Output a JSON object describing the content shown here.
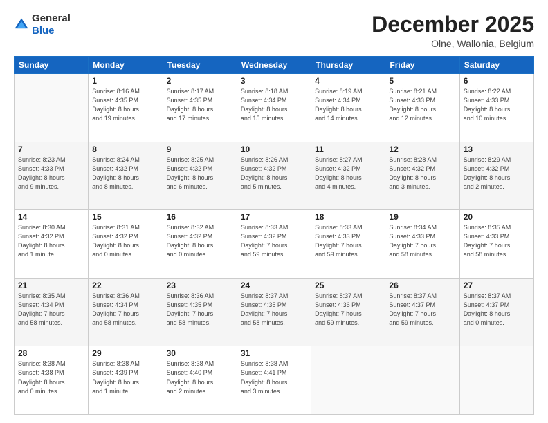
{
  "header": {
    "logo_general": "General",
    "logo_blue": "Blue",
    "month": "December 2025",
    "location": "Olne, Wallonia, Belgium"
  },
  "weekdays": [
    "Sunday",
    "Monday",
    "Tuesday",
    "Wednesday",
    "Thursday",
    "Friday",
    "Saturday"
  ],
  "weeks": [
    [
      {
        "day": "",
        "info": ""
      },
      {
        "day": "1",
        "info": "Sunrise: 8:16 AM\nSunset: 4:35 PM\nDaylight: 8 hours\nand 19 minutes."
      },
      {
        "day": "2",
        "info": "Sunrise: 8:17 AM\nSunset: 4:35 PM\nDaylight: 8 hours\nand 17 minutes."
      },
      {
        "day": "3",
        "info": "Sunrise: 8:18 AM\nSunset: 4:34 PM\nDaylight: 8 hours\nand 15 minutes."
      },
      {
        "day": "4",
        "info": "Sunrise: 8:19 AM\nSunset: 4:34 PM\nDaylight: 8 hours\nand 14 minutes."
      },
      {
        "day": "5",
        "info": "Sunrise: 8:21 AM\nSunset: 4:33 PM\nDaylight: 8 hours\nand 12 minutes."
      },
      {
        "day": "6",
        "info": "Sunrise: 8:22 AM\nSunset: 4:33 PM\nDaylight: 8 hours\nand 10 minutes."
      }
    ],
    [
      {
        "day": "7",
        "info": "Sunrise: 8:23 AM\nSunset: 4:33 PM\nDaylight: 8 hours\nand 9 minutes."
      },
      {
        "day": "8",
        "info": "Sunrise: 8:24 AM\nSunset: 4:32 PM\nDaylight: 8 hours\nand 8 minutes."
      },
      {
        "day": "9",
        "info": "Sunrise: 8:25 AM\nSunset: 4:32 PM\nDaylight: 8 hours\nand 6 minutes."
      },
      {
        "day": "10",
        "info": "Sunrise: 8:26 AM\nSunset: 4:32 PM\nDaylight: 8 hours\nand 5 minutes."
      },
      {
        "day": "11",
        "info": "Sunrise: 8:27 AM\nSunset: 4:32 PM\nDaylight: 8 hours\nand 4 minutes."
      },
      {
        "day": "12",
        "info": "Sunrise: 8:28 AM\nSunset: 4:32 PM\nDaylight: 8 hours\nand 3 minutes."
      },
      {
        "day": "13",
        "info": "Sunrise: 8:29 AM\nSunset: 4:32 PM\nDaylight: 8 hours\nand 2 minutes."
      }
    ],
    [
      {
        "day": "14",
        "info": "Sunrise: 8:30 AM\nSunset: 4:32 PM\nDaylight: 8 hours\nand 1 minute."
      },
      {
        "day": "15",
        "info": "Sunrise: 8:31 AM\nSunset: 4:32 PM\nDaylight: 8 hours\nand 0 minutes."
      },
      {
        "day": "16",
        "info": "Sunrise: 8:32 AM\nSunset: 4:32 PM\nDaylight: 8 hours\nand 0 minutes."
      },
      {
        "day": "17",
        "info": "Sunrise: 8:33 AM\nSunset: 4:32 PM\nDaylight: 7 hours\nand 59 minutes."
      },
      {
        "day": "18",
        "info": "Sunrise: 8:33 AM\nSunset: 4:33 PM\nDaylight: 7 hours\nand 59 minutes."
      },
      {
        "day": "19",
        "info": "Sunrise: 8:34 AM\nSunset: 4:33 PM\nDaylight: 7 hours\nand 58 minutes."
      },
      {
        "day": "20",
        "info": "Sunrise: 8:35 AM\nSunset: 4:33 PM\nDaylight: 7 hours\nand 58 minutes."
      }
    ],
    [
      {
        "day": "21",
        "info": "Sunrise: 8:35 AM\nSunset: 4:34 PM\nDaylight: 7 hours\nand 58 minutes."
      },
      {
        "day": "22",
        "info": "Sunrise: 8:36 AM\nSunset: 4:34 PM\nDaylight: 7 hours\nand 58 minutes."
      },
      {
        "day": "23",
        "info": "Sunrise: 8:36 AM\nSunset: 4:35 PM\nDaylight: 7 hours\nand 58 minutes."
      },
      {
        "day": "24",
        "info": "Sunrise: 8:37 AM\nSunset: 4:35 PM\nDaylight: 7 hours\nand 58 minutes."
      },
      {
        "day": "25",
        "info": "Sunrise: 8:37 AM\nSunset: 4:36 PM\nDaylight: 7 hours\nand 59 minutes."
      },
      {
        "day": "26",
        "info": "Sunrise: 8:37 AM\nSunset: 4:37 PM\nDaylight: 7 hours\nand 59 minutes."
      },
      {
        "day": "27",
        "info": "Sunrise: 8:37 AM\nSunset: 4:37 PM\nDaylight: 8 hours\nand 0 minutes."
      }
    ],
    [
      {
        "day": "28",
        "info": "Sunrise: 8:38 AM\nSunset: 4:38 PM\nDaylight: 8 hours\nand 0 minutes."
      },
      {
        "day": "29",
        "info": "Sunrise: 8:38 AM\nSunset: 4:39 PM\nDaylight: 8 hours\nand 1 minute."
      },
      {
        "day": "30",
        "info": "Sunrise: 8:38 AM\nSunset: 4:40 PM\nDaylight: 8 hours\nand 2 minutes."
      },
      {
        "day": "31",
        "info": "Sunrise: 8:38 AM\nSunset: 4:41 PM\nDaylight: 8 hours\nand 3 minutes."
      },
      {
        "day": "",
        "info": ""
      },
      {
        "day": "",
        "info": ""
      },
      {
        "day": "",
        "info": ""
      }
    ]
  ]
}
